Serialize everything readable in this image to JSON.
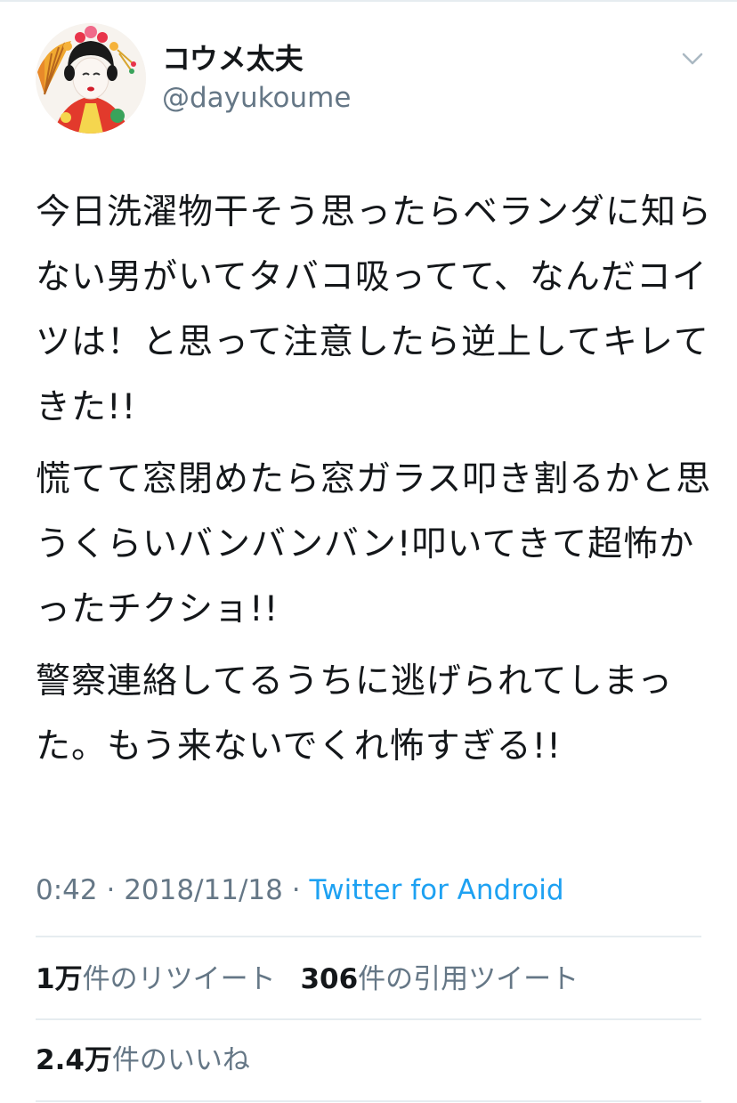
{
  "author": {
    "display_name": "コウメ太夫",
    "handle": "@dayukoume",
    "avatar_icon": "avatar-portrait"
  },
  "menu_icon": "chevron-down-icon",
  "tweet": {
    "paragraphs": [
      "今日洗濯物干そう思ったらベランダに知らない男がいてタバコ吸ってて、なんだコイツは！と思って注意したら逆上してキレてきた!!",
      "慌てて窓閉めたら窓ガラス叩き割るかと思うくらいバンバンバン!叩いてきて超怖かったチクショ!!",
      "警察連絡してるうちに逃げられてしまった。もう来ないでくれ怖すぎる!!"
    ]
  },
  "meta": {
    "time": "0:42",
    "date": "2018/11/18",
    "separator": " · ",
    "source": "Twitter for Android"
  },
  "stats": {
    "retweets_count": "1万",
    "retweets_label": "件のリツイート",
    "quotes_count": "306",
    "quotes_label": "件の引用ツイート",
    "likes_count": "2.4万",
    "likes_label": "件のいいね"
  },
  "colors": {
    "text": "#14171a",
    "secondary": "#657786",
    "link": "#1da1f2",
    "divider": "#e6ecf0"
  }
}
